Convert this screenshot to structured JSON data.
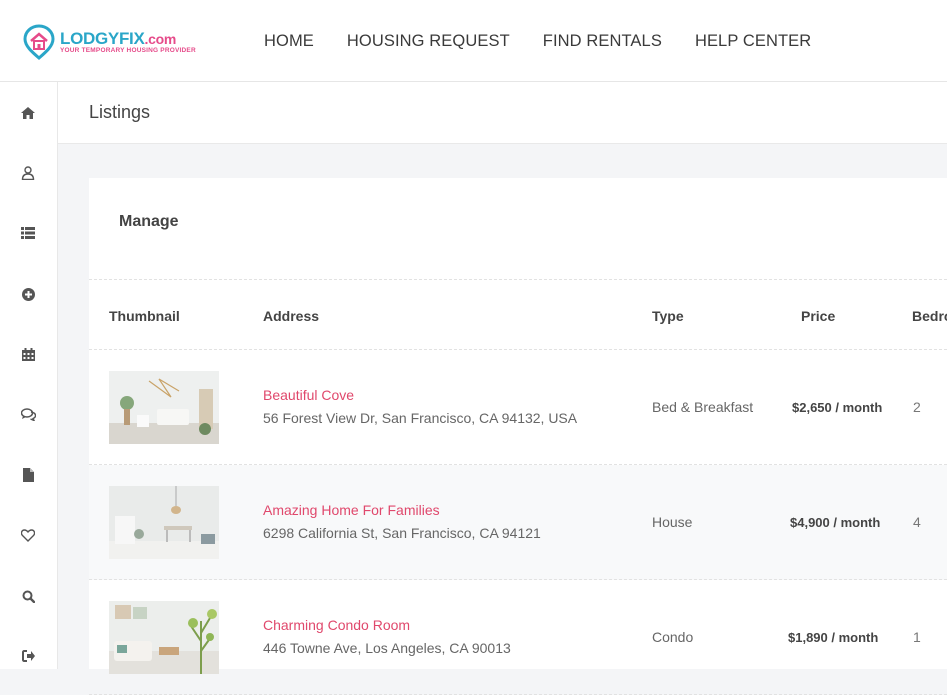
{
  "brand": {
    "name_part1": "LODGY",
    "name_part2": "FIX",
    "name_part3": ".com",
    "tagline": "YOUR TEMPORARY HOUSING PROVIDER",
    "colors": {
      "primary": "#2aa6c8",
      "accent": "#e64b8a"
    }
  },
  "nav": {
    "items": [
      {
        "label": "HOME"
      },
      {
        "label": "HOUSING REQUEST"
      },
      {
        "label": "FIND RENTALS"
      },
      {
        "label": "HELP CENTER"
      }
    ]
  },
  "sidebar": {
    "icons": [
      "home-icon",
      "user-icon",
      "list-icon",
      "add-circle-icon",
      "calendar-icon",
      "chat-icon",
      "document-icon",
      "heart-icon",
      "search-icon",
      "logout-icon"
    ]
  },
  "page": {
    "title": "Listings"
  },
  "card": {
    "title": "Manage",
    "columns": [
      "Thumbnail",
      "Address",
      "Type",
      "Price",
      "Bedro"
    ]
  },
  "listings": [
    {
      "name": "Beautiful Cove",
      "address": "56 Forest View Dr, San Francisco, CA 94132, USA",
      "type": "Bed & Breakfast",
      "price": "$2,650 / month",
      "beds": "2"
    },
    {
      "name": "Amazing Home For Families",
      "address": "6298 California St, San Francisco, CA 94121",
      "type": "House",
      "price": "$4,900 / month",
      "beds": "4"
    },
    {
      "name": "Charming Condo Room",
      "address": "446 Towne Ave, Los Angeles, CA 90013",
      "type": "Condo",
      "price": "$1,890 / month",
      "beds": "1"
    }
  ]
}
